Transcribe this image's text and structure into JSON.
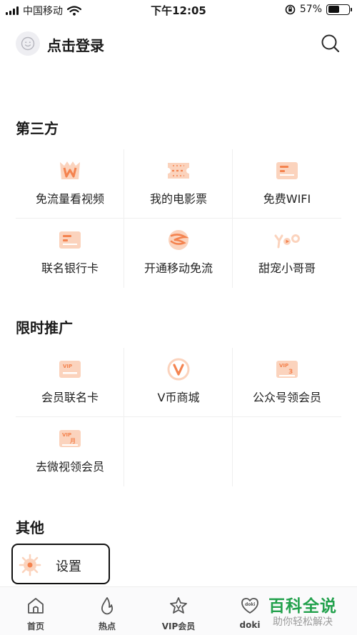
{
  "status_bar": {
    "carrier": "中国移动",
    "time": "下午12:05",
    "battery_percent": "57%",
    "battery_level": 0.57
  },
  "header": {
    "login_label": "点击登录",
    "avatar_icon": "smiley-face-icon",
    "search_icon": "search-icon"
  },
  "sections": {
    "third_party": {
      "title": "第三方",
      "items": [
        {
          "label": "免流量看视频",
          "icon": "crown-w-icon"
        },
        {
          "label": "我的电影票",
          "icon": "movie-ticket-icon"
        },
        {
          "label": "免费WIFI",
          "icon": "card-icon"
        },
        {
          "label": "联名银行卡",
          "icon": "bank-card-icon"
        },
        {
          "label": "开通移动免流",
          "icon": "china-mobile-logo-icon"
        },
        {
          "label": "甜宠小哥哥",
          "icon": "yoo-logo-icon"
        }
      ]
    },
    "promo": {
      "title": "限时推广",
      "items": [
        {
          "label": "会员联名卡",
          "icon": "vip-card-icon",
          "badge": "VIP"
        },
        {
          "label": "V币商城",
          "icon": "v-coin-icon",
          "badge": "V"
        },
        {
          "label": "公众号领会员",
          "icon": "vip-3-icon",
          "badge": "VIP",
          "sub_badge": "3"
        },
        {
          "label": "去微视领会员",
          "icon": "vip-month-icon",
          "badge": "VIP",
          "sub_badge": "月"
        }
      ]
    },
    "other": {
      "title": "其他",
      "settings_label": "设置",
      "settings_icon": "gear-icon"
    }
  },
  "tabbar": {
    "tabs": [
      {
        "label": "首页",
        "icon": "home-icon"
      },
      {
        "label": "热点",
        "icon": "flame-icon"
      },
      {
        "label": "VIP会员",
        "icon": "vip-star-icon"
      },
      {
        "label": "doki",
        "icon": "doki-heart-icon",
        "icon_text": "doki"
      }
    ]
  },
  "watermark": {
    "title": "百科全说",
    "subtitle": "助你轻松解决"
  },
  "colors": {
    "accent_orange": "#f4834f",
    "light_orange": "#fbd3bd",
    "watermark_green": "#23a14d"
  }
}
